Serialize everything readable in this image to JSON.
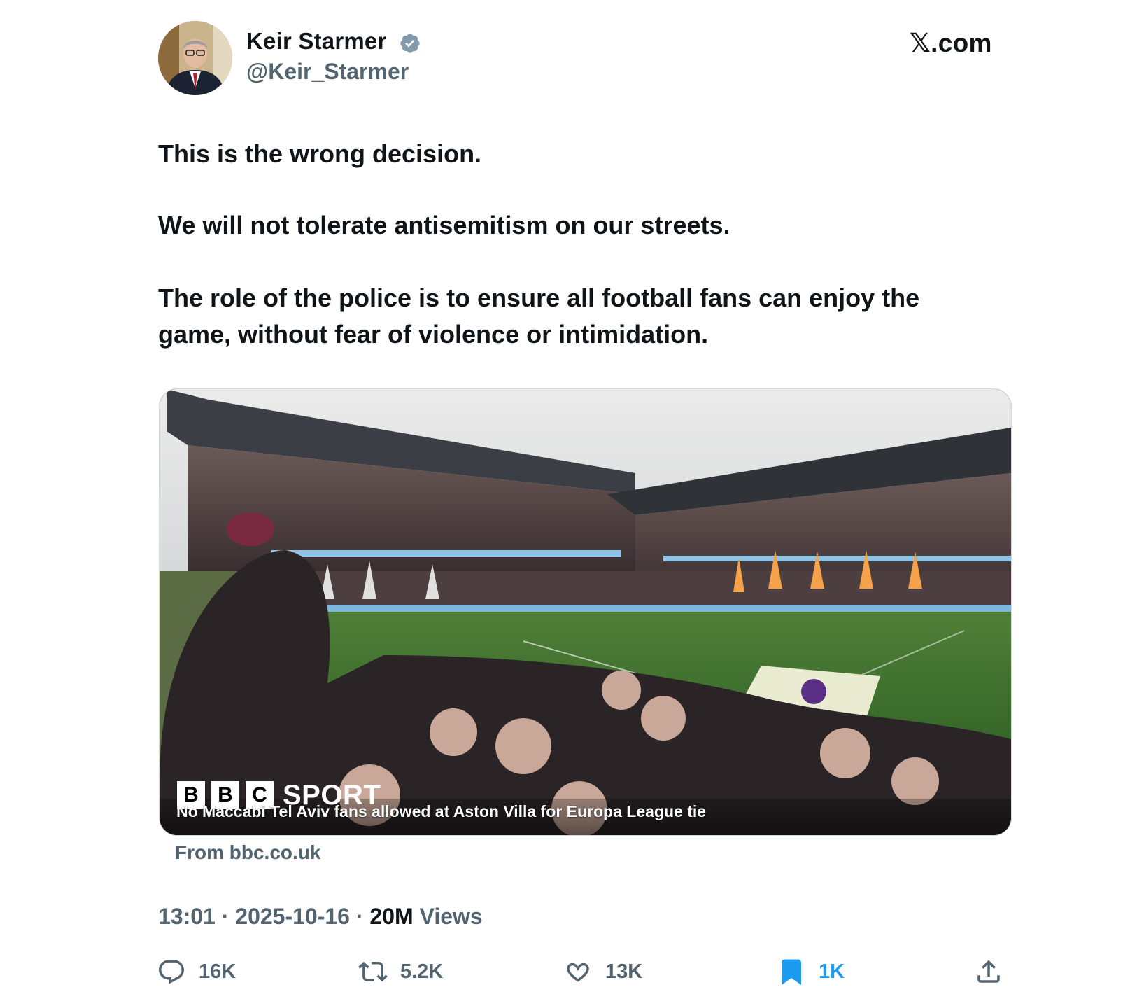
{
  "author": {
    "name": "Keir Starmer",
    "handle": "@Keir_Starmer",
    "verified": true,
    "verified_color": "#829aab"
  },
  "brand": "𝕏.com",
  "tweet": {
    "paragraphs": [
      "This is the wrong decision.",
      "We will not tolerate antisemitism on our streets.",
      "The role of the police is to ensure all football fans can enjoy the game, without fear of violence or intimidation."
    ]
  },
  "card": {
    "logo_letters": [
      "B",
      "B",
      "C"
    ],
    "logo_word": "SPORT",
    "title": "No Maccabi Tel Aviv fans allowed at Aston Villa for Europa League tie",
    "source": "From bbc.co.uk",
    "image_icon": "stadium-photo"
  },
  "meta": {
    "time": "13:01",
    "date": "2025-10-16",
    "views_count": "20M",
    "views_label": "Views",
    "separator": "·"
  },
  "actions": {
    "replies": "16K",
    "reposts": "5.2K",
    "likes": "13K",
    "bookmarks": "1K",
    "bookmark_color": "#1d9bf0"
  }
}
